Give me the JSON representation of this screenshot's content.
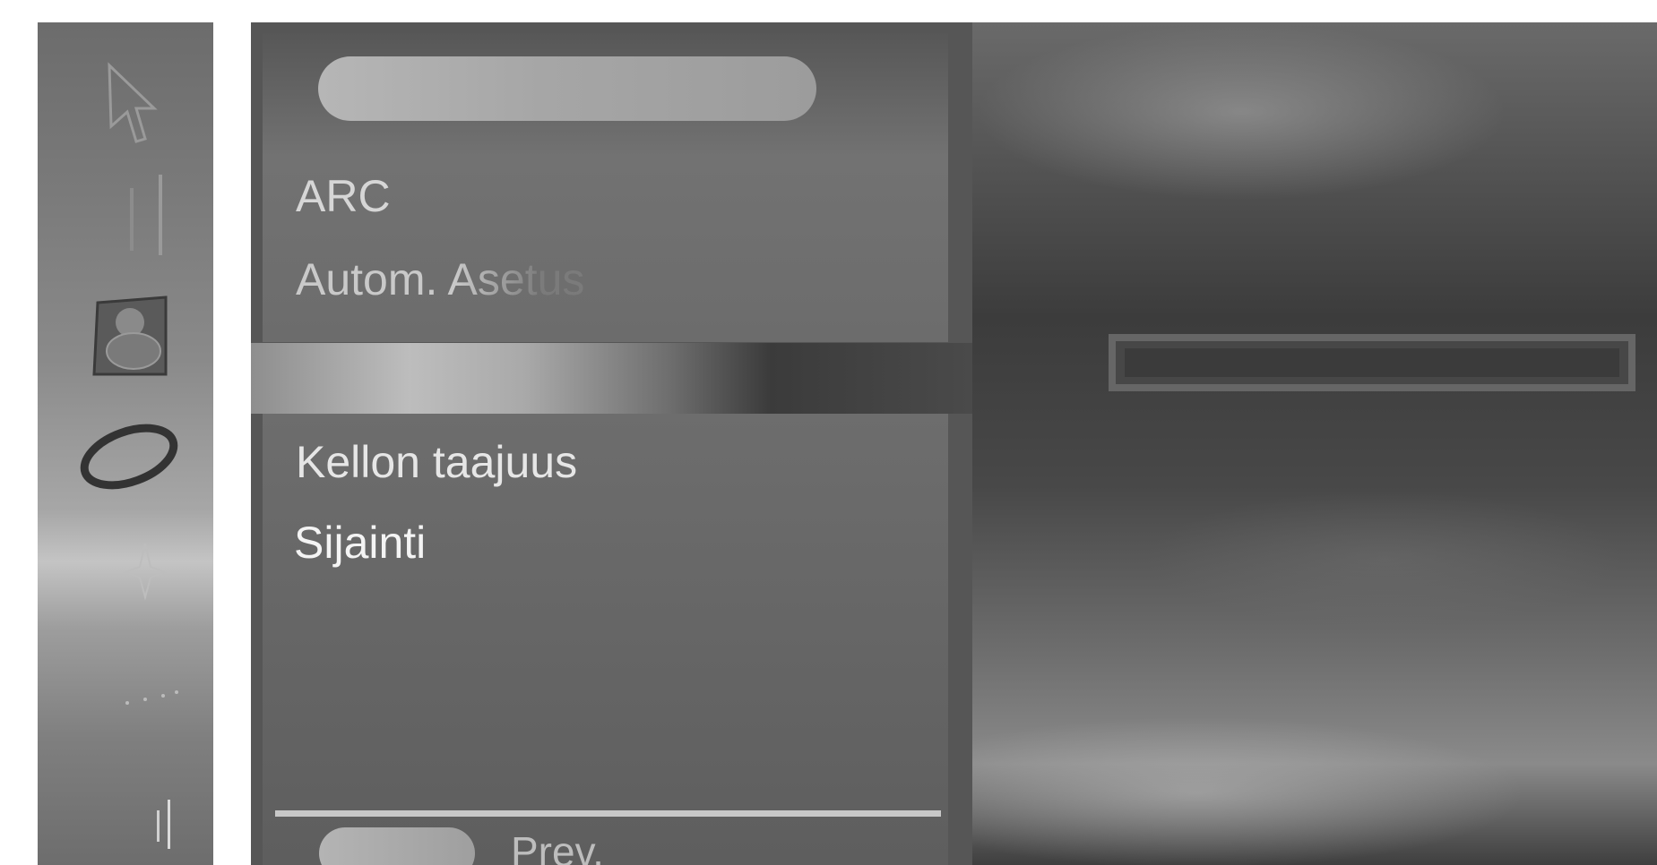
{
  "sidebar": {
    "icons": [
      {
        "name": "cursor-arrow-icon"
      },
      {
        "name": "vertical-bars-icon"
      },
      {
        "name": "disc-icon"
      },
      {
        "name": "ring-icon"
      },
      {
        "name": "star-icon"
      },
      {
        "name": "dots-icon"
      },
      {
        "name": "lines-icon"
      }
    ]
  },
  "menu": {
    "title": "",
    "items_top": [
      {
        "label": "ARC"
      },
      {
        "label": "Autom. Asetus"
      }
    ],
    "items_bottom": [
      {
        "label": "Kellon taajuus"
      },
      {
        "label": "Sijainti"
      }
    ],
    "selected_item": "Sijainti"
  },
  "footer": {
    "prev_label": "Prev."
  },
  "colors": {
    "panel_background": "#565656",
    "selected_text": "#f4f4f4",
    "normal_text": "#d6d6d6"
  }
}
